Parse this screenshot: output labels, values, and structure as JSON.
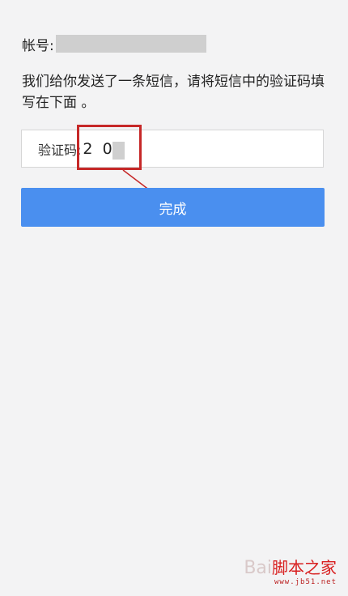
{
  "account": {
    "label": "帐号:"
  },
  "instruction": {
    "text": "我们给你发送了一条短信，请将短信中的验证码填写在下面 。"
  },
  "verification": {
    "label": "验证码:",
    "value": "2  0"
  },
  "done_button": {
    "label": "完成"
  },
  "watermark": {
    "prefix": "Bai",
    "brand": "脚本之家",
    "url": "www.jb51.net"
  },
  "colors": {
    "background": "#f3f3f4",
    "button": "#4a8fef",
    "highlight": "#c62828"
  }
}
